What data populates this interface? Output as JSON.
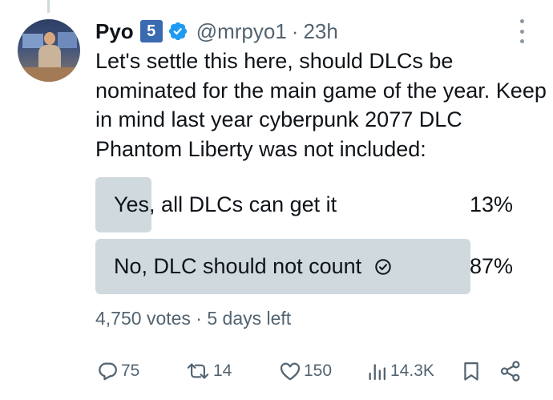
{
  "user": {
    "display_name": "Pyo",
    "badge_number": "5",
    "handle": "@mrpyo1",
    "separator": "·",
    "time": "23h"
  },
  "tweet": {
    "text": "Let's settle this here, should DLCs be nominated for the main game of the year. Keep in mind last year cyberpunk 2077 DLC Phantom Liberty was not included:"
  },
  "poll": {
    "options": [
      {
        "label": "Yes, all DLCs can get it",
        "percent_text": "13%",
        "share": 0.13,
        "selected": false
      },
      {
        "label": "No, DLC should not count",
        "percent_text": "87%",
        "share": 0.87,
        "selected": true
      }
    ],
    "meta": "4,750 votes · 5 days left"
  },
  "actions": {
    "replies": "75",
    "reposts": "14",
    "likes": "150",
    "views": "14.3K"
  },
  "icons": {
    "verified": "verified-badge-icon",
    "more": "more-options-icon",
    "reply": "reply-icon",
    "repost": "repost-icon",
    "like": "heart-icon",
    "views": "views-chart-icon",
    "bookmark": "bookmark-icon",
    "share": "share-icon",
    "selected_choice": "check-circle-icon"
  },
  "colors": {
    "accent": "#1d9bf0",
    "poll_bar": "#cfd9de",
    "muted_text": "#536471",
    "badge_bg": "#3a6ab0"
  }
}
